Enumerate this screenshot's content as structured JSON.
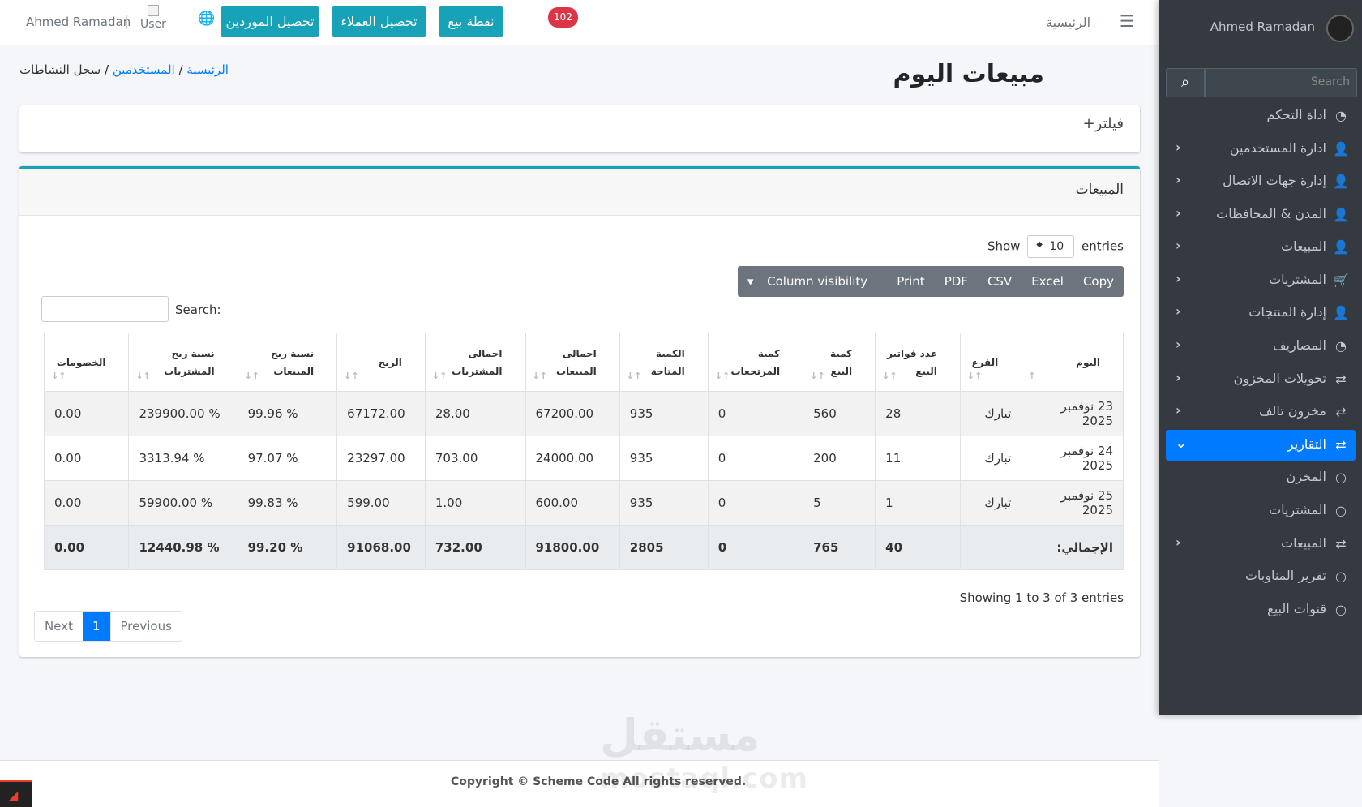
{
  "navbar": {
    "user_name": "Ahmed Ramadan",
    "user_img_alt": "User",
    "btn_suppliers": "تحصيل الموردين",
    "btn_customers": "تحصيل العملاء",
    "btn_pos": "نقطة بيع",
    "badge_count": "102",
    "home": "الرئيسية"
  },
  "sidebar": {
    "user_name": "Ahmed Ramadan",
    "search_placeholder": "Search",
    "items": [
      {
        "label": "اداة التحكم"
      },
      {
        "label": "ادارة المستخدمين"
      },
      {
        "label": "إدارة جهات الاتصال"
      },
      {
        "label": "المدن & المحافظات"
      },
      {
        "label": "المبيعات"
      },
      {
        "label": "المشتريات"
      },
      {
        "label": "إدارة المنتجات"
      },
      {
        "label": "المصاريف"
      },
      {
        "label": "تحويلات المخزون"
      },
      {
        "label": "مخزون تالف"
      },
      {
        "label": "التقارير"
      },
      {
        "label": "المخزن"
      },
      {
        "label": "المشتريات"
      },
      {
        "label": "المبيعات"
      },
      {
        "label": "تقرير المناوبات"
      },
      {
        "label": "قنوات البيع"
      }
    ]
  },
  "page": {
    "title": "مبيعات اليوم",
    "breadcrumb": {
      "home": "الرئيسية",
      "users": "المستخدمين",
      "current": "سجل النشاطات"
    },
    "filter_title": "فيلتر",
    "sales_title": "المبيعات"
  },
  "datatable": {
    "show": "Show",
    "entries_value": "10",
    "entries": "entries",
    "buttons": {
      "copy": "Copy",
      "excel": "Excel",
      "csv": "CSV",
      "pdf": "PDF",
      "print": "Print",
      "colvis": "Column visibility"
    },
    "search_label": "Search:",
    "columns": [
      [
        "اليوم",
        ""
      ],
      [
        "الفرع",
        ""
      ],
      [
        "عدد فواتير",
        "البيع"
      ],
      [
        "كمية",
        "البيع"
      ],
      [
        "كمية",
        "المرتجعات"
      ],
      [
        "الكمية",
        "المتاحة"
      ],
      [
        "اجمالى",
        "المبيعات"
      ],
      [
        "اجمالى",
        "المشتريات"
      ],
      [
        "الربح",
        ""
      ],
      [
        "نسبة ربح",
        "المبيعات"
      ],
      [
        "نسبة ربح",
        "المشتريات"
      ],
      [
        "الخصومات",
        ""
      ]
    ],
    "rows": [
      [
        "23 نوفمبر 2025",
        "تبارك",
        "28",
        "560",
        "0",
        "935",
        "67200.00",
        "28.00",
        "67172.00",
        "% 99.96",
        "% 239900.00",
        "0.00"
      ],
      [
        "24 نوفمبر 2025",
        "تبارك",
        "11",
        "200",
        "0",
        "935",
        "24000.00",
        "703.00",
        "23297.00",
        "% 97.07",
        "% 3313.94",
        "0.00"
      ],
      [
        "25 نوفمبر 2025",
        "تبارك",
        "1",
        "5",
        "0",
        "935",
        "600.00",
        "1.00",
        "599.00",
        "% 99.83",
        "% 59900.00",
        "0.00"
      ]
    ],
    "total": [
      "الإجمالي:",
      "40",
      "765",
      "0",
      "2805",
      "91800.00",
      "732.00",
      "91068.00",
      "% 99.20",
      "% 12440.98",
      "0.00"
    ],
    "info": "Showing 1 to 3 of 3 entries",
    "pager": {
      "previous": "Previous",
      "page": "1",
      "next": "Next"
    }
  },
  "footer": {
    "copyright": "Copyright © Scheme Code All rights reserved."
  },
  "watermark": {
    "ar": "مستقل",
    "en": "mostaql.com"
  }
}
